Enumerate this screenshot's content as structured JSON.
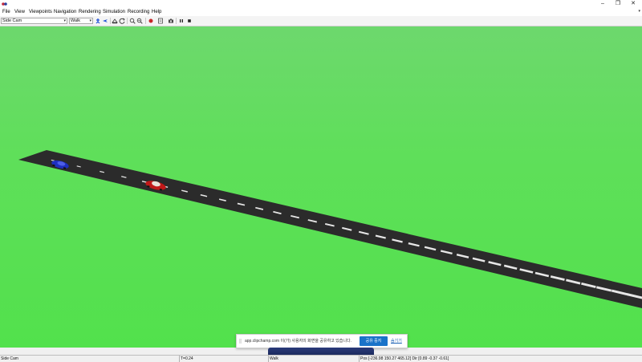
{
  "window": {
    "minimize": "–",
    "maximize": "❐",
    "close": "✕"
  },
  "menu": [
    "File",
    "View",
    "Viewpoints",
    "Navigation",
    "Rendering",
    "Simulation",
    "Recording",
    "Help"
  ],
  "menu_expand": "▾",
  "toolbar": {
    "viewpoint_select": "Side Cam",
    "navigation_select": "Walk"
  },
  "status": {
    "viewpoint": "Side Cam",
    "time": "T=0.24",
    "mode": "Walk",
    "position": "Pos [-236.98 150.27 465.12] Dir [0.89 -0.37 -0.61]"
  },
  "share": {
    "message": "app.clipchamp.com 이(가) 사용자의 화면을 공유하고 있습니다.",
    "stop_label": "공유 중지",
    "hide_label": "숨기기"
  },
  "colors": {
    "ground": "#5fdf5a",
    "road": "#2d2d2d",
    "car_blue": "#1e2fbf",
    "car_red": "#c01818",
    "share_button": "#1a73c9"
  }
}
